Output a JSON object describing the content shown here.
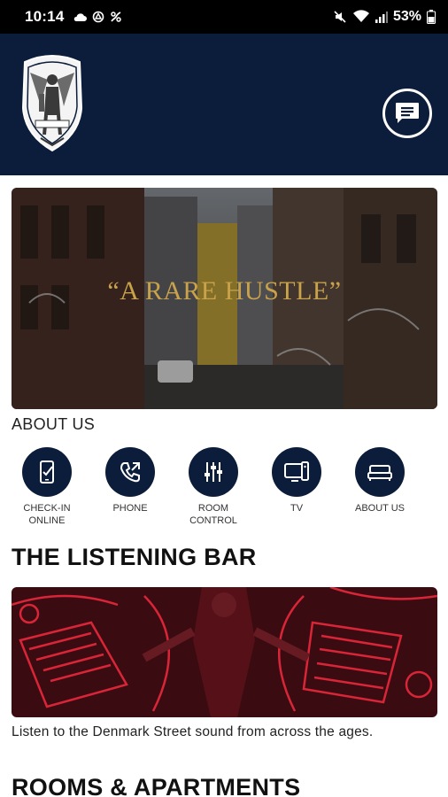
{
  "status_bar": {
    "time": "10:14",
    "battery": "53%"
  },
  "header": {
    "logo_icon": "hotel-crest-logo",
    "chat_icon": "chat-icon"
  },
  "hero": {
    "quote": "“A RARE HUSTLE”"
  },
  "about": {
    "label": "ABOUT US"
  },
  "quick_actions": [
    {
      "label": "CHECK-IN\nONLINE",
      "icon": "mobile-checkin-icon"
    },
    {
      "label": "PHONE",
      "icon": "phone-icon"
    },
    {
      "label": "ROOM\nCONTROL",
      "icon": "sliders-icon"
    },
    {
      "label": "TV",
      "icon": "tv-icon"
    },
    {
      "label": "ABOUT US",
      "icon": "bed-icon"
    }
  ],
  "listening_bar": {
    "title": "THE LISTENING BAR",
    "caption": "Listen to the Denmark Street sound from across the ages."
  },
  "rooms": {
    "title": "ROOMS & APARTMENTS"
  },
  "colors": {
    "navy": "#0b1d3a",
    "gold": "#c9a24a",
    "neon_red": "#e0283a"
  }
}
